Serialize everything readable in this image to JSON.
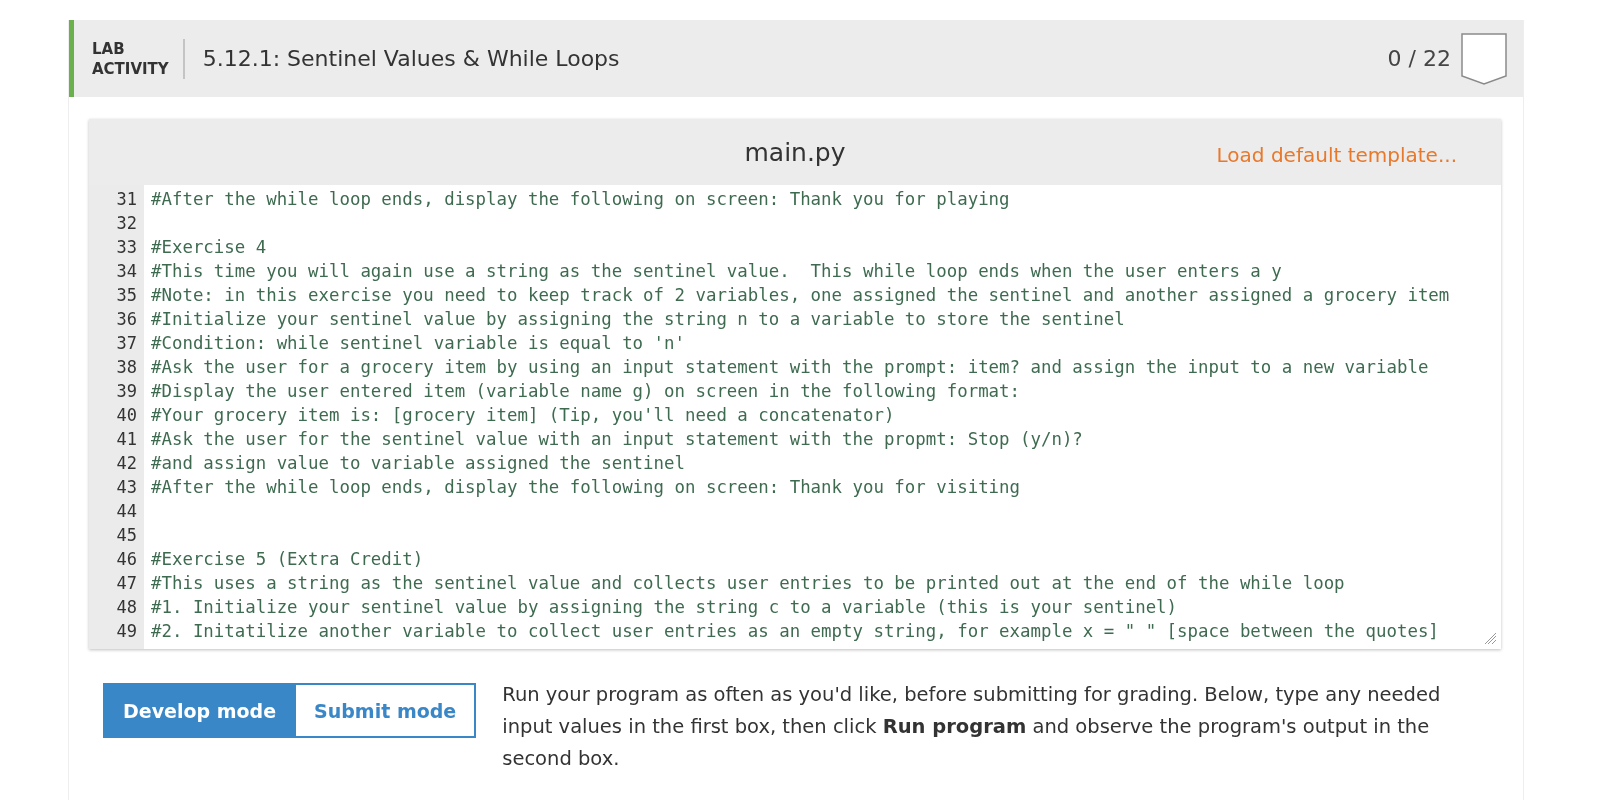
{
  "activity": {
    "label": [
      "LAB",
      "ACTIVITY"
    ],
    "title": "5.12.1: Sentinel Values & While Loops",
    "score": "0 / 22"
  },
  "editor": {
    "filename": "main.py",
    "template_link": "Load default template...",
    "lines": [
      {
        "number": "31",
        "text": "#After the while loop ends, display the following on screen: Thank you for playing"
      },
      {
        "number": "32"
      },
      {
        "number": "33",
        "text": "#Exercise 4"
      },
      {
        "number": "34",
        "text": "#This time you will again use a string as the sentinel value.  This while loop ends when the user enters a y"
      },
      {
        "number": "35",
        "text": "#Note: in this exercise you need to keep track of 2 variables, one assigned the sentinel and another assigned a grocery item"
      },
      {
        "number": "36",
        "text": "#Initialize your sentinel value by assigning the string n to a variable to store the sentinel"
      },
      {
        "number": "37",
        "text": "#Condition: while sentinel variable is equal to 'n'"
      },
      {
        "number": "38",
        "text": "#Ask the user for a grocery item by using an input statement with the prompt: item? and assign the input to a new variable"
      },
      {
        "number": "39",
        "text": "#Display the user entered item (variable name g) on screen in the following format:"
      },
      {
        "number": "40",
        "text": "#Your grocery item is: [grocery item] (Tip, you'll need a concatenator)"
      },
      {
        "number": "41",
        "text": "#Ask the user for the sentinel value with an input statement with the propmt: Stop (y/n)?"
      },
      {
        "number": "42",
        "text": "#and assign value to variable assigned the sentinel"
      },
      {
        "number": "43",
        "text": "#After the while loop ends, display the following on screen: Thank you for visiting"
      },
      {
        "number": "44"
      },
      {
        "number": "45"
      },
      {
        "number": "46",
        "text": "#Exercise 5 (Extra Credit)"
      },
      {
        "number": "47",
        "text": "#This uses a string as the sentinel value and collects user entries to be printed out at the end of the while loop"
      },
      {
        "number": "48",
        "text": "#1. Initialize your sentinel value by assigning the string c to a variable (this is your sentinel)"
      },
      {
        "number": "49",
        "text": "#2. Initatilize another variable to collect user entries as an empty string, for example x = \" \" [space between the quotes]"
      }
    ]
  },
  "modes": [
    {
      "label": "Develop mode",
      "selected": true
    },
    {
      "label": "Submit mode",
      "selected": false
    }
  ],
  "instructions": "Run your program as often as you'd like, before submitting for grading. Below, type any needed input values in the first box, then click **Run program** and observe the program's output in the second box."
}
